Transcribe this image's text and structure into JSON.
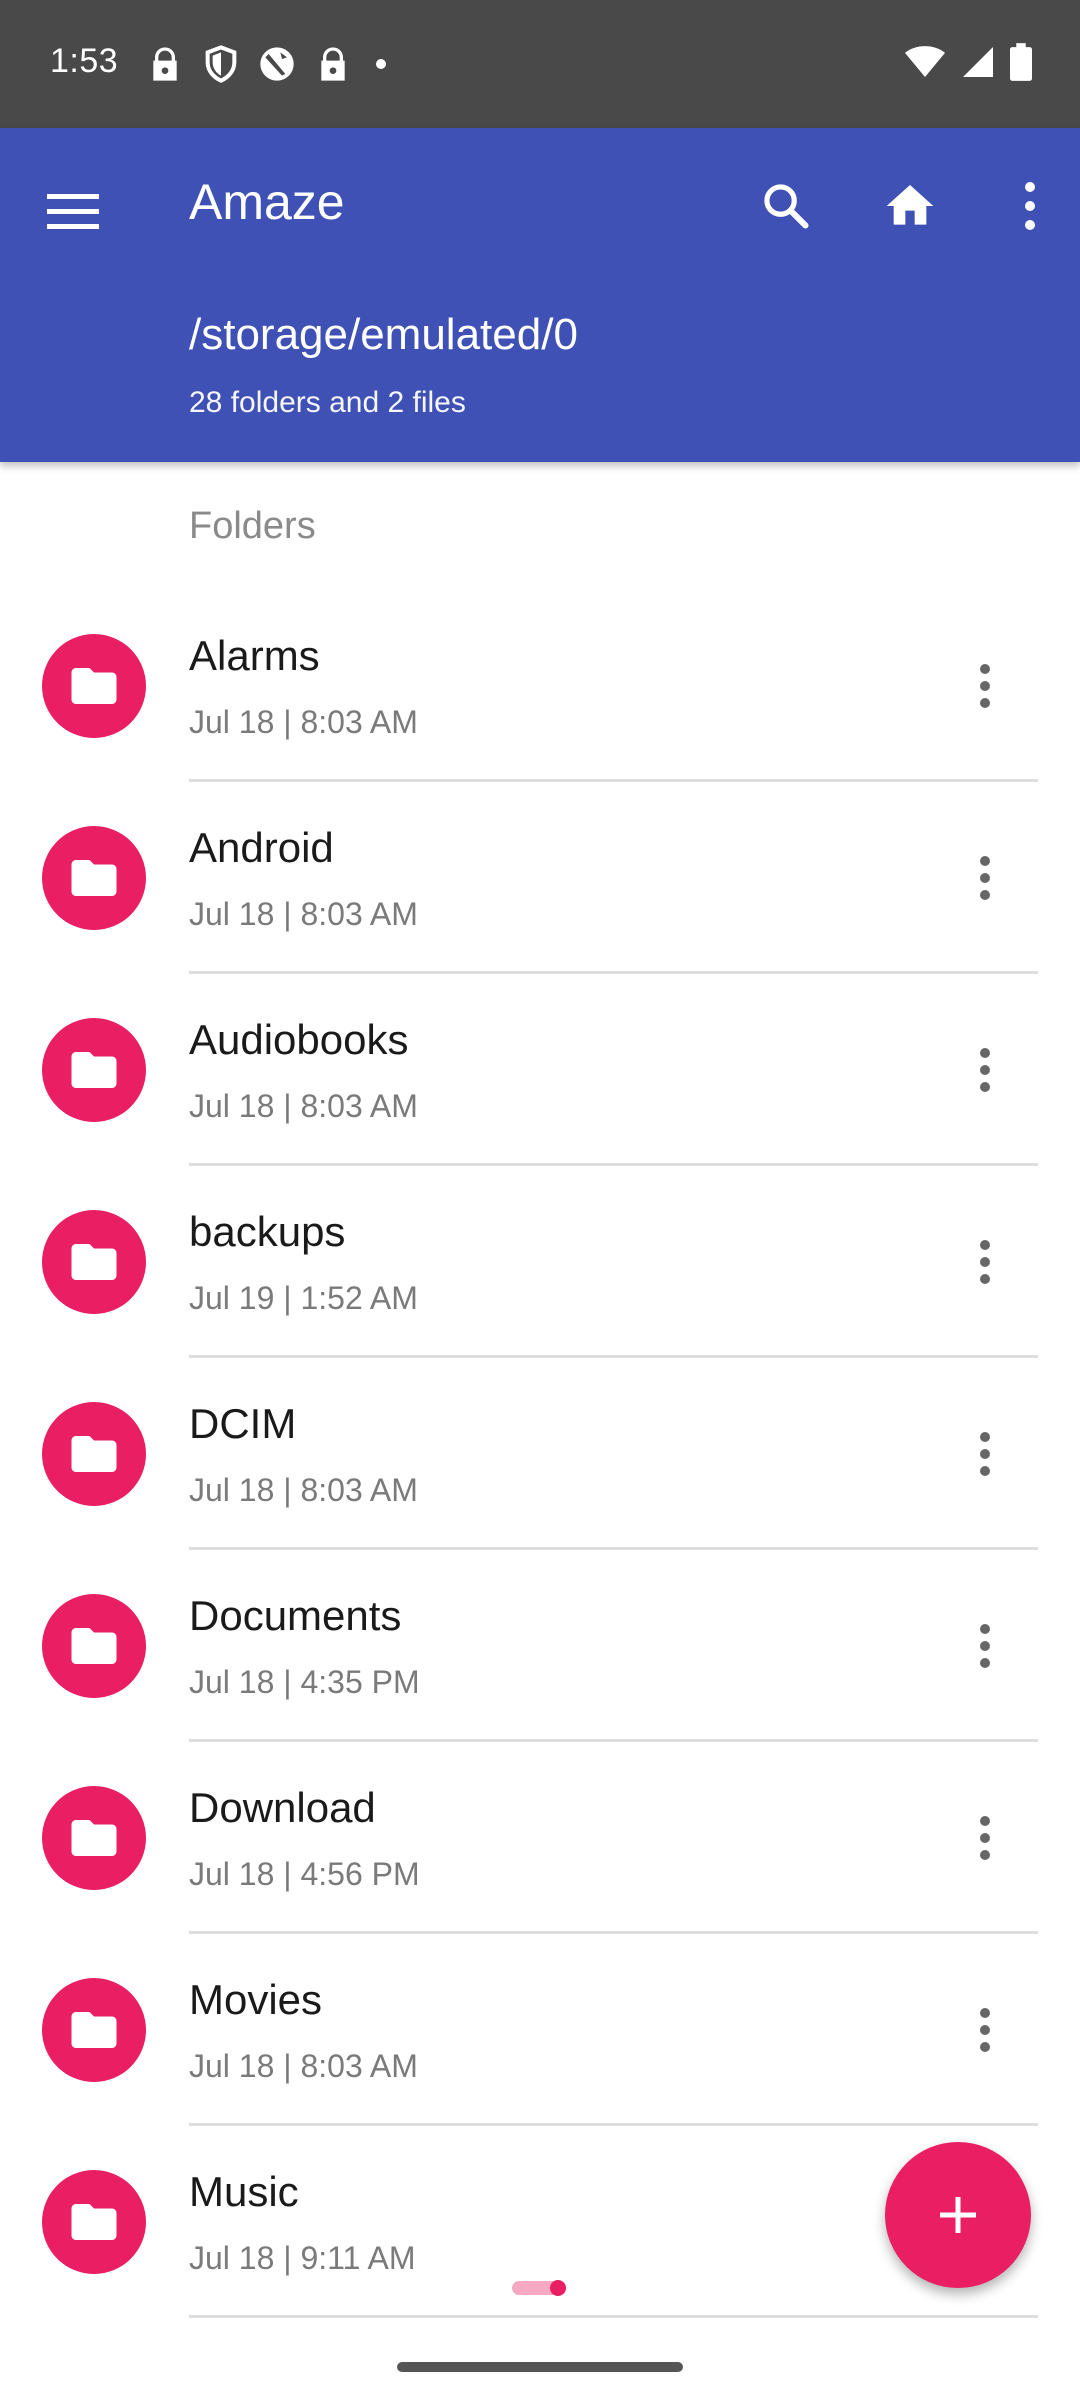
{
  "status_bar": {
    "time": "1:53",
    "icons": [
      "lock-icon",
      "shield-icon",
      "vpn-icon",
      "lock-icon",
      "dot-icon"
    ],
    "right_icons": [
      "wifi-icon",
      "signal-icon",
      "battery-icon"
    ]
  },
  "toolbar": {
    "title": "Amaze",
    "path": "/storage/emulated/0",
    "summary": "28 folders and 2 files",
    "color": "#3f51b5"
  },
  "section": {
    "folders_label": "Folders"
  },
  "folders": [
    {
      "name": "Alarms",
      "date": "Jul 18 | 8:03 AM"
    },
    {
      "name": "Android",
      "date": "Jul 18 | 8:03 AM"
    },
    {
      "name": "Audiobooks",
      "date": "Jul 18 | 8:03 AM"
    },
    {
      "name": "backups",
      "date": "Jul 19 | 1:52 AM"
    },
    {
      "name": "DCIM",
      "date": "Jul 18 | 8:03 AM"
    },
    {
      "name": "Documents",
      "date": "Jul 18 | 4:35 PM"
    },
    {
      "name": "Download",
      "date": "Jul 18 | 4:56 PM"
    },
    {
      "name": "Movies",
      "date": "Jul 18 | 8:03 AM"
    },
    {
      "name": "Music",
      "date": "Jul 18 | 9:11 AM"
    }
  ],
  "accent_color": "#e91e63"
}
